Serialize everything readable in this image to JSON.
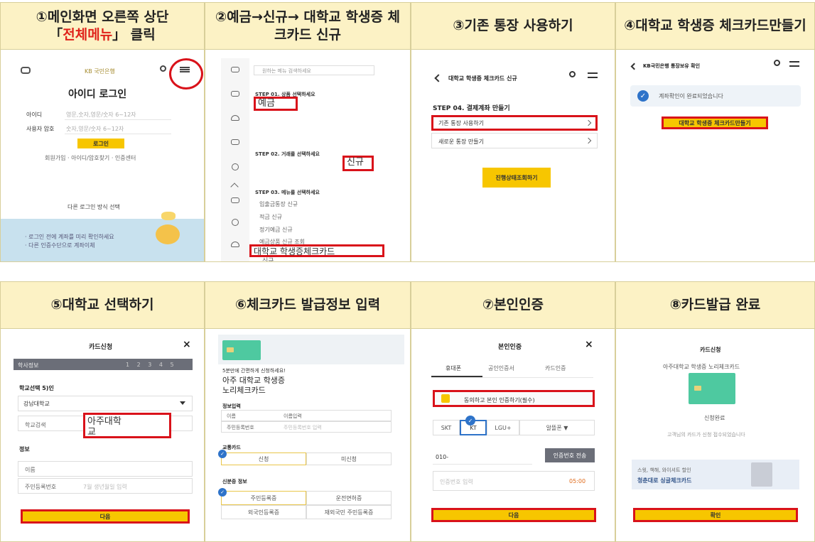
{
  "steps": [
    {
      "num": "①",
      "title_pre": "메인화면 오른쪽 상단",
      "title_open": "「",
      "title_red": "전체메뉴",
      "title_close": "」 클릭"
    },
    {
      "num": "②",
      "title": "예금→신규→ 대학교 학생증 체크카드 신규"
    },
    {
      "num": "③",
      "title": "기존 통장 사용하기"
    },
    {
      "num": "④",
      "title": "대학교 학생증 체크카드만들기"
    },
    {
      "num": "⑤",
      "title": "대학교 선택하기"
    },
    {
      "num": "⑥",
      "title": "체크카드 발급정보 입력"
    },
    {
      "num": "⑦",
      "title": "본인인증"
    },
    {
      "num": "⑧",
      "title": "카드발급 완료"
    }
  ],
  "s1": {
    "logo": "KB 국민은행",
    "login_title": "아이디 로그인",
    "id_label": "아이디",
    "id_placeholder": "영문,숫자,영문/숫자 6~12자",
    "pw_label": "사용자 암호",
    "pw_placeholder": "숫자,영문/숫자 6~12자",
    "login_btn": "로그인",
    "links": "회원가입 · 아이디/암호찾기 · 인증센터",
    "other_login": "다른 로그인 방식 선택",
    "banner_line1": "· 로그인 전에 계좌를 미리 확인하세요",
    "banner_line2": "· 다른 인증수단으로 계좌이체"
  },
  "s2": {
    "search_placeholder": "원하는 메뉴 검색하세요",
    "step1": "STEP 01. 상품 선택하세요",
    "hl_deposit": "예금",
    "hl_new": "신규",
    "step2": "STEP 02. 거래를 선택하세요",
    "step3": "STEP 03. 메뉴를 선택하세요",
    "menu_items": [
      "입출금통장 신규",
      "적금 신규",
      "정기예금 신규",
      "예금상품 신규 조회"
    ],
    "hl_card": "대학교 학생증체크카드",
    "hl_card_sub": "신규"
  },
  "s3": {
    "header": "대학교 학생증 체크카드 신규",
    "step": "STEP 04. 결제계좌 만들기",
    "opt1": "기존 통장 사용하기",
    "opt2": "새로운 통장 만들기",
    "btn": "진행상태조회하기"
  },
  "s4": {
    "header": "KB국민은행 통장보유 확인",
    "confirm": "계좌확인이 완료되었습니다",
    "btn": "대학교 학생증 체크카드만들기"
  },
  "s5": {
    "title": "카드신청",
    "close": "×",
    "bar_label": "학사정보",
    "progress": "1 2 3 4 5",
    "school_label": "학교선택 5)인",
    "school_value": "강남대학교",
    "school_search": "학교검색",
    "hl_school_line1": "아주대학",
    "hl_school_line2": "교",
    "info_label": "정보",
    "name_label": "이름",
    "rrn_label": "주민등록번호",
    "rrn_placeholder": "7월 생년월일 입력",
    "next": "다음"
  },
  "s6": {
    "headline_small": "5분만에 간편하게 신청하세요!",
    "headline_line1": "아주 대학교 학생증",
    "headline_line2": "노리체크카드",
    "section1": "정보입력",
    "row1_label": "이름",
    "row1_value": "이름입력",
    "row2_label": "주민등록번호",
    "row2_value": "주민등록번호 입력",
    "section2": "교통카드",
    "toggle_on": "신청",
    "toggle_off": "미신청",
    "section3": "신분증 정보",
    "id_opt1": "주민등록증",
    "id_opt2": "운전면허증",
    "id_opt3": "외국인등록증",
    "id_opt4": "재외국민 주민등록증"
  },
  "s7": {
    "title": "본인인증",
    "close": "×",
    "tabs": [
      "휴대폰",
      "공인인증서",
      "카드인증"
    ],
    "agree": "동의하고 본인 인증하기(필수)",
    "carriers": [
      "SKT",
      "KT",
      "LGU+",
      "알뜰폰 ▼"
    ],
    "phone_label": "010-",
    "send_btn": "인증번호 전송",
    "code_placeholder": "인증번호 입력",
    "timer": "05:00",
    "next": "다음"
  },
  "s8": {
    "title": "카드신청",
    "card_name": "아주대학교 학생증 노리체크카드",
    "done": "신청완료",
    "done_sub": "고객님의 카드가 신청 접수되었습니다",
    "promo_small": "스윗, 책해, 와이셔트 할인",
    "promo_big": "청춘대로 싱글체크카드",
    "confirm": "확인"
  },
  "colors": {
    "header_bg": "#fcf2c5",
    "highlight": "#d9121a",
    "kb_yellow": "#f7c600",
    "accent_blue": "#2e73c9"
  }
}
